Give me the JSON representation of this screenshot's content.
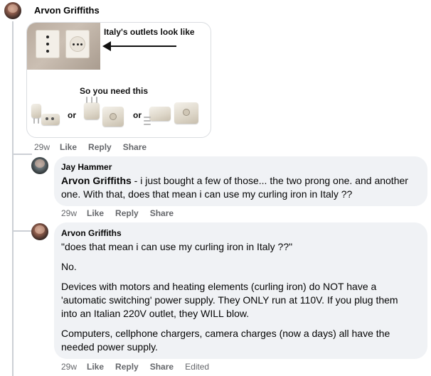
{
  "comment1": {
    "author": "Arvon Griffiths",
    "image": {
      "caption_top": "Italy's outlets look like",
      "caption_mid": "So you need this",
      "or_1": "or",
      "or_2": "or"
    },
    "time": "29w",
    "like": "Like",
    "reply": "Reply",
    "share": "Share"
  },
  "comment2": {
    "author": "Jay Hammer",
    "mention": "Arvon Griffiths",
    "text": " - i just bought a few of those... the two prong one. and another one. With that, does that mean i can use my curling iron in Italy ??",
    "time": "29w",
    "like": "Like",
    "reply": "Reply",
    "share": "Share"
  },
  "comment3": {
    "author": "Arvon Griffiths",
    "paragraphs": [
      "\"does that mean i can use my curling iron in Italy ??\"",
      "No.",
      "Devices with motors and heating elements (curling iron) do NOT have a 'automatic switching' power supply. They ONLY run at 110V. If you plug them into an Italian 220V outlet, they WILL blow.",
      "Computers, cellphone chargers, camera charges (now a days) all have the needed power supply."
    ],
    "time": "29w",
    "like": "Like",
    "reply": "Reply",
    "share": "Share",
    "edited": "Edited"
  }
}
